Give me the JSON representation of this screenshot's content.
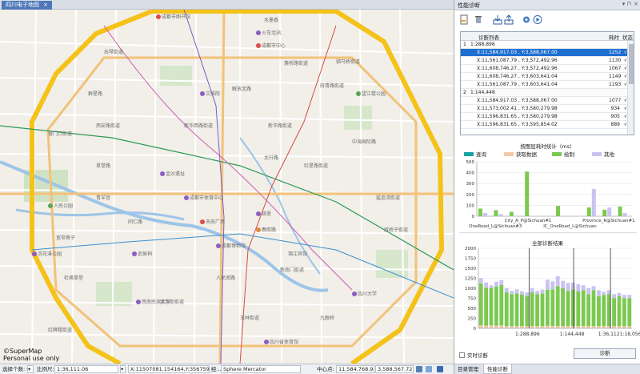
{
  "map_tab": {
    "title": "四川电子地图",
    "close": "×"
  },
  "map": {
    "copyright_line1": "©SuperMap",
    "copyright_line2": "Personal use only",
    "labels": [
      "成都市图书馆",
      "水墨香",
      "成都市中心",
      "抚琴街道",
      "群星路",
      "解放北路",
      "簇桥路街道",
      "新华西路街道",
      "新华路街道",
      "中海国际路",
      "金沙遗址",
      "成都市体育中心",
      "望江楼公园",
      "人民公园",
      "天府广场",
      "锦里",
      "武侯祠",
      "春熙路",
      "红星路街道",
      "四川大学",
      "宽窄巷子",
      "文殊院",
      "青羊宫",
      "杜甫草堂",
      "新南门街道",
      "玉林街道",
      "浆洗街街道",
      "火车北站",
      "太升路",
      "草堂路",
      "人民南路",
      "成都博物馆",
      "浣花溪公园",
      "西南民族大学",
      "驷马桥街道",
      "猛追湾街道",
      "双桥子街道",
      "府青路街道",
      "锦江宾馆",
      "九眼桥",
      "四川省体育馆",
      "同仁路",
      "营门口街道",
      "西安路街道",
      "红牌楼街道"
    ]
  },
  "status_bar": {
    "selected_label": "选择个数: 0",
    "scale_label": "比例尺:",
    "scale_value": "1:36,111.06",
    "coords": "X:11507081.154164,Y:3567598.825465",
    "coords_suffix": "经...",
    "projection": "Sphere Mercator",
    "center_label": "中心点:",
    "center_x": "11,584,768.93...",
    "center_y": "3,588,567.727..."
  },
  "panel": {
    "title": "性能诊断",
    "pin": "▾ ⊓",
    "close": "×",
    "table": {
      "headers": {
        "list": "诊断列表",
        "time": "耗时",
        "state": "状态"
      },
      "rows": [
        {
          "kind": "group",
          "idx": "1",
          "label": "1:288,896"
        },
        {
          "kind": "item",
          "label": "X:11,584,917.03 , Y:3,588,067.00",
          "time": "1252",
          "state": "√",
          "selected": true
        },
        {
          "kind": "item",
          "label": "X:11,561,087.79 , Y:3,572,492.96",
          "time": "1130",
          "state": "√"
        },
        {
          "kind": "item",
          "label": "X:11,608,746.27 , Y:3,572,492.96",
          "time": "1067",
          "state": "√"
        },
        {
          "kind": "item",
          "label": "X:11,608,746.27 , Y:3,603,641.04",
          "time": "1149",
          "state": "√"
        },
        {
          "kind": "item",
          "label": "X:11,561,087.79 , Y:3,603,641.04",
          "time": "1193",
          "state": "√"
        },
        {
          "kind": "group",
          "idx": "2",
          "label": "1:144,448"
        },
        {
          "kind": "item",
          "label": "X:11,584,917.03 , Y:3,588,067.00",
          "time": "1077",
          "state": "√"
        },
        {
          "kind": "item",
          "label": "X:11,573,002.41 , Y:3,580,279.98",
          "time": "934",
          "state": "√"
        },
        {
          "kind": "item",
          "label": "X:11,596,831.65 , Y:3,580,279.98",
          "time": "905",
          "state": "√"
        },
        {
          "kind": "item",
          "label": "X:11,596,831.65 , Y:3,595,854.02",
          "time": "889",
          "state": "√"
        }
      ]
    },
    "realtime_label": "实时诊断",
    "diagnose_button": "诊断",
    "bottom_tabs": [
      "目录管理",
      "性能诊断"
    ],
    "colors": {
      "query": "#1aa3a3",
      "fetch": "#f5c9a8",
      "draw": "#7bc950",
      "other": "#c9c3f0",
      "selection": "#1e6fd0"
    }
  },
  "chart_data": [
    {
      "type": "bar",
      "title": "按图层耗时统计（ms）",
      "legend": [
        "查询",
        "获取数据",
        "绘制",
        "其他"
      ],
      "legend_position": "top",
      "ylim": [
        0,
        500
      ],
      "y_ticks": [
        0,
        100,
        200,
        300,
        400,
        500
      ],
      "categories": [
        "OneRoad_L@Sichuan#3",
        "City_A_P@Sichuan#1",
        "IC_OneRoad_L@Sichuan",
        "Province_R@Sichuan#1"
      ],
      "tick_labels_upper": [
        "City_A_P@Sichuan#1",
        "Province_R@Sichuan#1"
      ],
      "tick_labels_lower": [
        "OneRoad_L@Sichuan#3",
        "IC_OneRoad_L@Sichuan"
      ],
      "groups": [
        {
          "draw": 70,
          "other": 30
        },
        {
          "draw": 55,
          "other": 20
        },
        {
          "draw": 40,
          "other": 0
        },
        {
          "draw": 410,
          "other": 0
        },
        {
          "draw": 0,
          "other": 0
        },
        {
          "draw": 95,
          "other": 0
        },
        {
          "draw": 0,
          "other": 0
        },
        {
          "draw": 80,
          "other": 250
        },
        {
          "draw": 60,
          "other": 80
        },
        {
          "draw": 90,
          "other": 30
        }
      ]
    },
    {
      "type": "bar",
      "title": "全部诊断结果",
      "ylim": [
        0,
        2000
      ],
      "y_ticks": [
        0,
        250,
        500,
        750,
        1000,
        1250,
        1500,
        1750,
        2000
      ],
      "x_tick_labels": [
        "1:288,896",
        "1:144,448",
        "1:36,112",
        "1:18,056"
      ],
      "series": [
        {
          "name": "查询",
          "values": [
            5,
            5,
            5,
            5,
            5,
            5,
            5,
            5,
            5,
            5,
            5,
            5,
            5,
            5,
            5,
            5,
            5,
            5,
            5,
            5,
            5,
            5,
            5,
            5,
            5,
            5,
            5,
            5,
            5,
            5
          ]
        },
        {
          "name": "获取数据",
          "values": [
            70,
            60,
            70,
            60,
            70,
            50,
            50,
            50,
            50,
            50,
            50,
            50,
            50,
            60,
            50,
            50,
            50,
            50,
            50,
            50,
            50,
            50,
            50,
            50,
            50,
            50,
            50,
            50,
            50,
            50
          ]
        },
        {
          "name": "绘制",
          "values": [
            1050,
            950,
            930,
            980,
            1010,
            850,
            800,
            820,
            790,
            750,
            850,
            800,
            820,
            900,
            920,
            1000,
            950,
            880,
            920,
            870,
            900,
            800,
            900,
            750,
            780,
            800,
            700,
            750,
            700,
            700
          ]
        },
        {
          "name": "其他",
          "values": [
            130,
            130,
            70,
            120,
            120,
            100,
            80,
            100,
            80,
            90,
            100,
            80,
            90,
            250,
            200,
            250,
            180,
            200,
            170,
            180,
            120,
            150,
            100,
            150,
            80,
            100,
            100,
            80,
            80,
            80
          ]
        }
      ]
    }
  ]
}
